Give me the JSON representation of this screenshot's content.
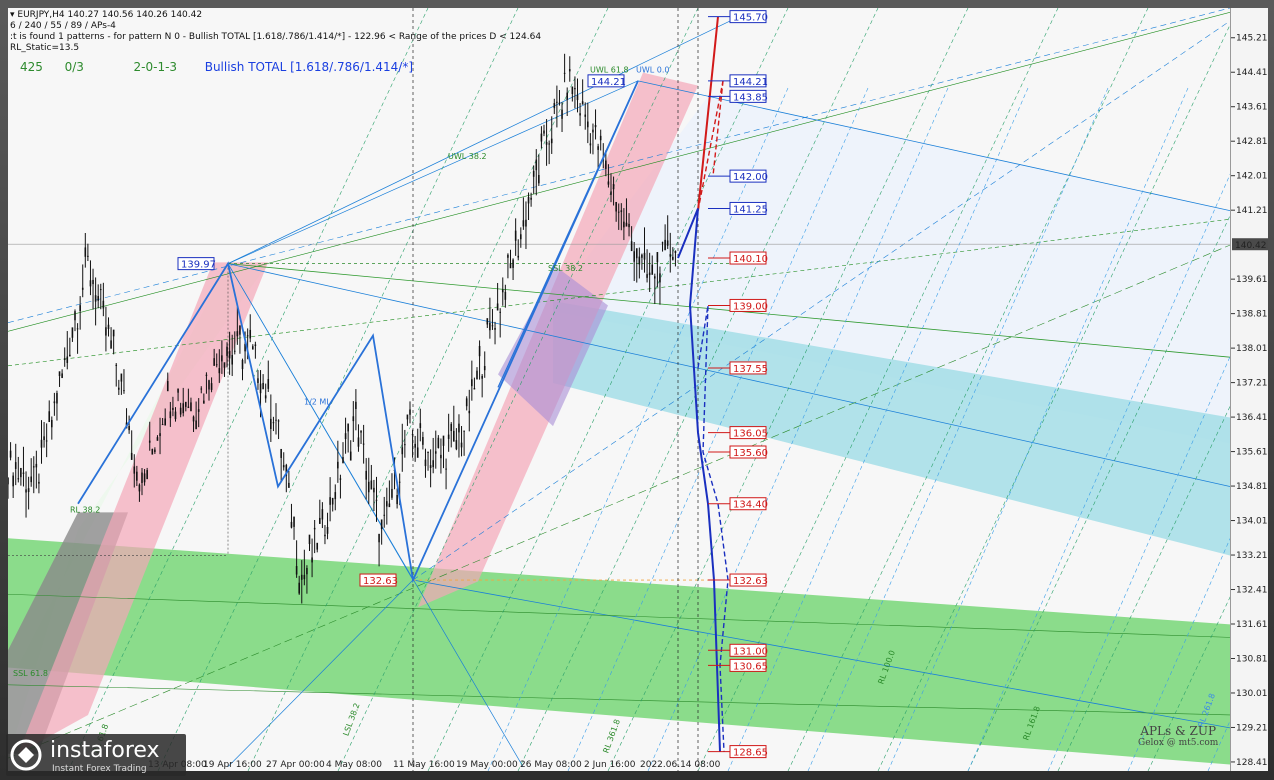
{
  "header": {
    "symbol": "EURJPY,H4",
    "ohlc": "140.27 140.56 140.26 140.42",
    "line2": "6 / 240 / 55 / 89 / APs-4",
    "line3": ":t is found 1 patterns  -  for pattern N 0 - Bullish TOTAL [1.618/.786/1.414/*] - 122.96 < Range of the prices D < 124.64",
    "line4": "RL_Static=13.5",
    "stat1": "425",
    "stat2": "0/3",
    "stat3": "2-0-1-3",
    "pattern_name": "Bullish TOTAL [1.618/.786/1.414/*]"
  },
  "colors": {
    "green_text": "#2e8b2e",
    "blue_text": "#1a3fe0",
    "red_box": "#d01818",
    "blue_box": "#1a2fbf",
    "pink_channel": "#f4a6b8",
    "green_zone": "#6fd46f",
    "cyan_zone": "#9fdce6",
    "current_price": "#4a4a4a"
  },
  "chart_data": {
    "type": "candlestick",
    "title": "EURJPY,H4",
    "y_axis": {
      "ticks": [
        "145.21",
        "144.41",
        "143.61",
        "142.81",
        "142.01",
        "141.21",
        "140.42",
        "139.61",
        "138.81",
        "138.01",
        "137.21",
        "136.41",
        "135.61",
        "134.81",
        "134.01",
        "133.21",
        "132.41",
        "131.61",
        "130.81",
        "130.01",
        "129.21",
        "128.41"
      ],
      "ylim": [
        128.2,
        145.9
      ],
      "current_price": 140.42
    },
    "x_axis": {
      "ticks": [
        "13 Apr 08:00",
        "19 Apr 16:00",
        "27 Apr 00:00",
        "4 May 08:00",
        "11 May 16:00",
        "19 May 00:00",
        "26 May 08:00",
        "2 Jun 16:00",
        "2022.06.14 08:00"
      ]
    },
    "price_path": [
      {
        "t": "13 Apr",
        "price": 135.3
      },
      {
        "t": "15 Apr",
        "price": 134.8
      },
      {
        "t": "18 Apr",
        "price": 137.3
      },
      {
        "t": "20 Apr",
        "price": 139.97
      },
      {
        "t": "22 Apr",
        "price": 137.8
      },
      {
        "t": "25 Apr",
        "price": 134.8
      },
      {
        "t": "27 Apr",
        "price": 137.0
      },
      {
        "t": "29 Apr",
        "price": 136.7
      },
      {
        "t": "3 May",
        "price": 137.9
      },
      {
        "t": "5 May",
        "price": 138.1
      },
      {
        "t": "9 May",
        "price": 136.5
      },
      {
        "t": "12 May",
        "price": 132.63
      },
      {
        "t": "13 May",
        "price": 134.2
      },
      {
        "t": "17 May",
        "price": 136.4
      },
      {
        "t": "19 May",
        "price": 133.6
      },
      {
        "t": "23 May",
        "price": 136.1
      },
      {
        "t": "25 May",
        "price": 135.4
      },
      {
        "t": "27 May",
        "price": 136.0
      },
      {
        "t": "31 May",
        "price": 138.3
      },
      {
        "t": "2 Jun",
        "price": 140.2
      },
      {
        "t": "6 Jun",
        "price": 142.5
      },
      {
        "t": "8 Jun",
        "price": 144.21
      },
      {
        "t": "9 Jun",
        "price": 142.9
      },
      {
        "t": "10 Jun",
        "price": 141.0
      },
      {
        "t": "13 Jun",
        "price": 139.6
      },
      {
        "t": "14 Jun",
        "price": 140.42
      }
    ],
    "price_labels": [
      {
        "text": "145.70",
        "value": 145.7,
        "kind": "blue"
      },
      {
        "text": "144.21",
        "value": 144.21,
        "kind": "blue"
      },
      {
        "text": "143.85",
        "value": 143.85,
        "kind": "blue"
      },
      {
        "text": "142.00",
        "value": 142.0,
        "kind": "blue"
      },
      {
        "text": "141.25",
        "value": 141.25,
        "kind": "blue"
      },
      {
        "text": "140.10",
        "value": 140.1,
        "kind": "red"
      },
      {
        "text": "139.00",
        "value": 139.0,
        "kind": "red"
      },
      {
        "text": "137.55",
        "value": 137.55,
        "kind": "red"
      },
      {
        "text": "136.05",
        "value": 136.05,
        "kind": "red"
      },
      {
        "text": "135.60",
        "value": 135.6,
        "kind": "red"
      },
      {
        "text": "134.40",
        "value": 134.4,
        "kind": "red"
      },
      {
        "text": "132.63",
        "value": 132.63,
        "kind": "red"
      },
      {
        "text": "131.00",
        "value": 131.0,
        "kind": "red"
      },
      {
        "text": "130.65",
        "value": 130.65,
        "kind": "red"
      },
      {
        "text": "128.65",
        "value": 128.65,
        "kind": "red"
      }
    ],
    "pivot_labels": [
      {
        "text": "139.97",
        "value": 139.97,
        "kind": "blue"
      },
      {
        "text": "144.21",
        "value": 144.21,
        "kind": "blue"
      },
      {
        "text": "132.63",
        "value": 132.63,
        "kind": "red"
      }
    ],
    "annotations": [
      "1/2 ML",
      "UWL 38.2",
      "UWL 61.8",
      "UWL 0.0",
      "SSL 38.2",
      "SSL 61.8",
      "LSL 38.2",
      "RL 100.0",
      "RL 161.8",
      "RL 261.8",
      "RL 361.8",
      "RL 61.8",
      "RL 38.2",
      "LSL 38.2"
    ]
  },
  "credit": {
    "line1": "APLs & ZUP",
    "line2": "Gelox @ mt5.com"
  },
  "logo": {
    "name": "instaforex",
    "tagline": "Instant Forex Trading"
  }
}
